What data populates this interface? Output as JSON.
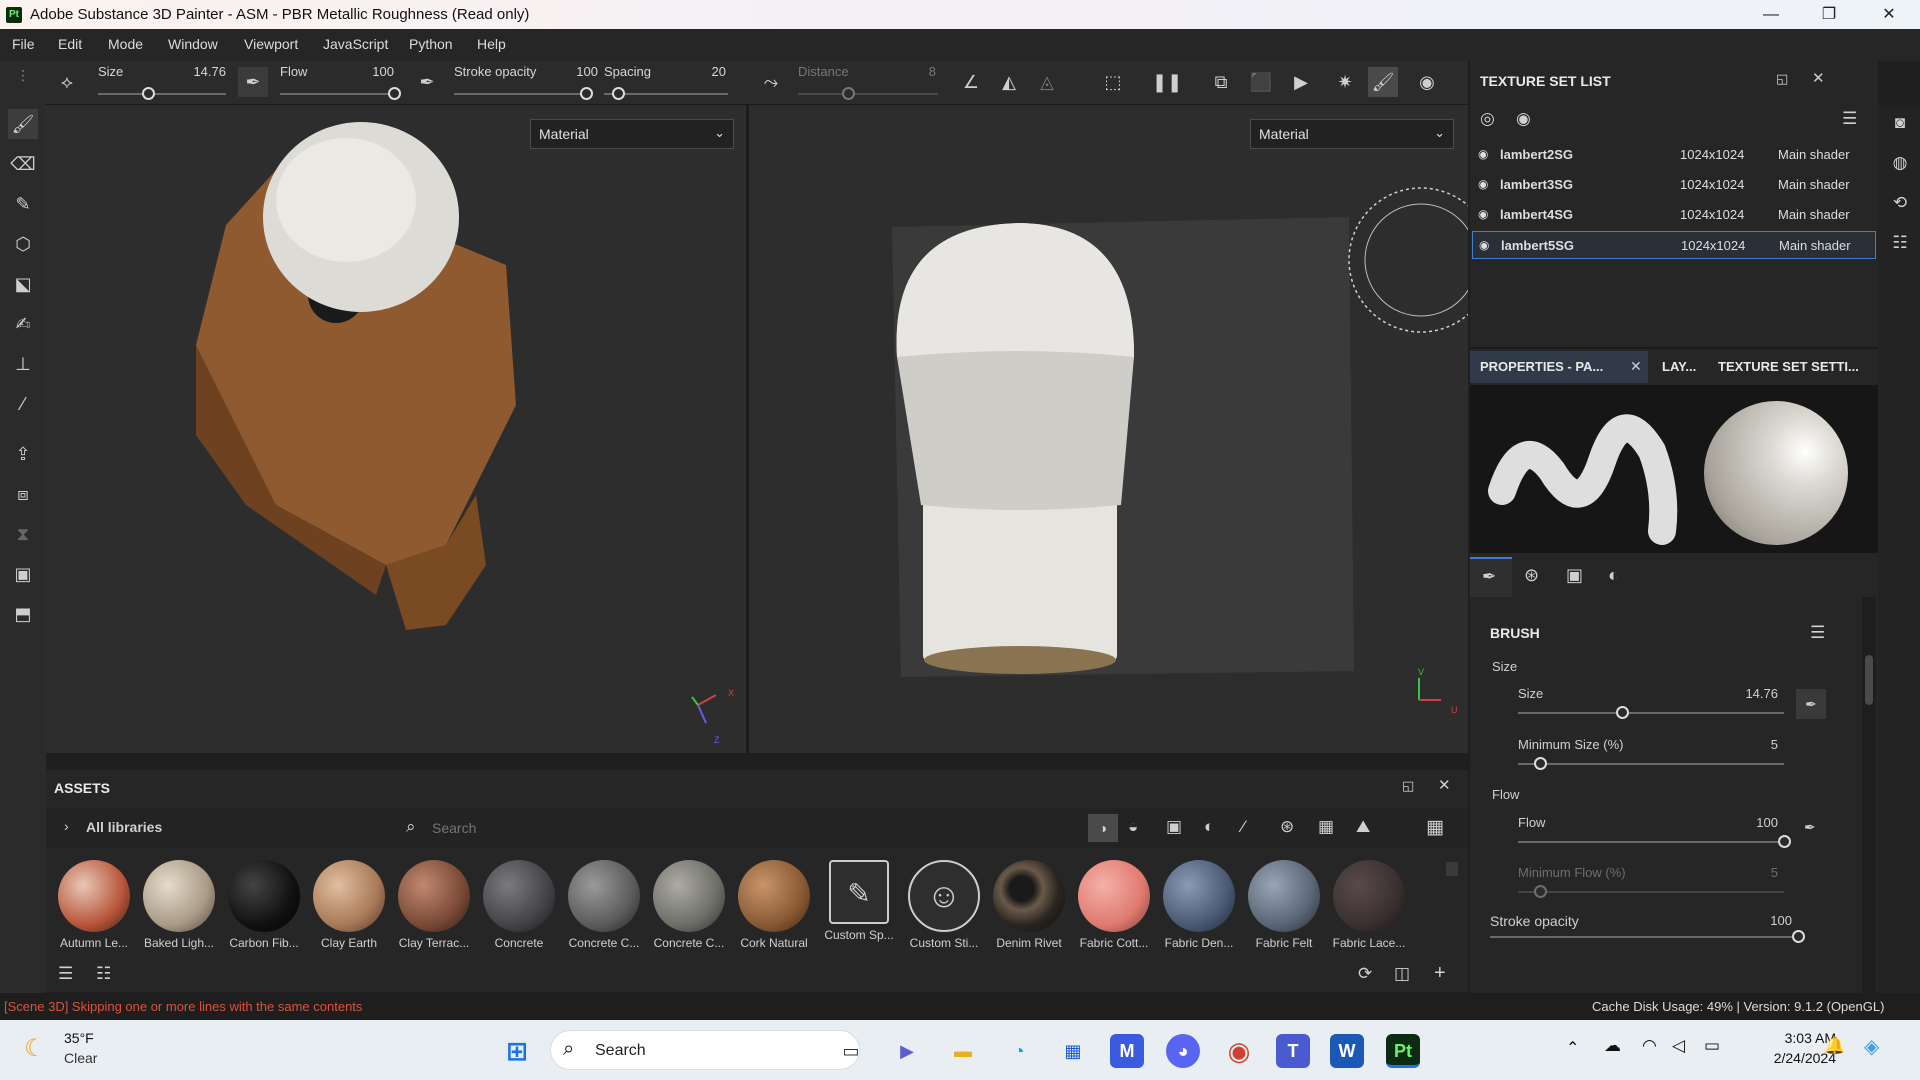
{
  "window": {
    "app_icon": "Pt",
    "title": "Adobe Substance 3D Painter - ASM - PBR Metallic Roughness (Read only)"
  },
  "menu": [
    "File",
    "Edit",
    "Mode",
    "Window",
    "Viewport",
    "JavaScript",
    "Python",
    "Help"
  ],
  "toolbar": {
    "size_label": "Size",
    "size_value": "14.76",
    "flow_label": "Flow",
    "flow_value": "100",
    "stroke_label": "Stroke opacity",
    "stroke_value": "100",
    "spacing_label": "Spacing",
    "spacing_value": "20",
    "distance_label": "Distance",
    "distance_value": "8"
  },
  "viewport3d": {
    "dropdown": "Material",
    "axis_x": "X",
    "axis_z": "Z"
  },
  "viewport2d": {
    "dropdown": "Material",
    "axis_v": "V",
    "axis_u": "U"
  },
  "texture_set_list": {
    "title": "TEXTURE SET LIST",
    "rows": [
      {
        "name": "lambert2SG",
        "res": "1024x1024",
        "shader": "Main shader"
      },
      {
        "name": "lambert3SG",
        "res": "1024x1024",
        "shader": "Main shader"
      },
      {
        "name": "lambert4SG",
        "res": "1024x1024",
        "shader": "Main shader"
      },
      {
        "name": "lambert5SG",
        "res": "1024x1024",
        "shader": "Main shader"
      }
    ]
  },
  "properties": {
    "tabs": [
      "PROPERTIES - PA...",
      "LAY...",
      "TEXTURE SET SETTI..."
    ],
    "brush_title": "BRUSH",
    "size_group": "Size",
    "size_label": "Size",
    "size_value": "14.76",
    "minsize_label": "Minimum Size (%)",
    "minsize_value": "5",
    "flow_group": "Flow",
    "flow_label": "Flow",
    "flow_value": "100",
    "minflow_label": "Minimum Flow (%)",
    "minflow_value": "5",
    "stroke_label": "Stroke opacity",
    "stroke_value": "100"
  },
  "assets": {
    "title": "ASSETS",
    "libraries": "All libraries",
    "search_placeholder": "Search",
    "items": [
      {
        "name": "Autumn Le...",
        "color": "#b8563a"
      },
      {
        "name": "Baked Ligh...",
        "color": "#a89a86"
      },
      {
        "name": "Carbon Fib...",
        "color": "#111111"
      },
      {
        "name": "Clay Earth",
        "color": "#a87a58"
      },
      {
        "name": "Clay Terrac...",
        "color": "#7a4a36"
      },
      {
        "name": "Concrete",
        "color": "#444448"
      },
      {
        "name": "Concrete C...",
        "color": "#5c5c5c"
      },
      {
        "name": "Concrete C...",
        "color": "#6e6e68"
      },
      {
        "name": "Cork Natural",
        "color": "#8a5a34"
      },
      {
        "name": "Custom Sp...",
        "color": "#2e2e2e"
      },
      {
        "name": "Custom Sti...",
        "color": "#2e2e2e"
      },
      {
        "name": "Denim Rivet",
        "color": "#2a2520"
      },
      {
        "name": "Fabric Cott...",
        "color": "#e07a70"
      },
      {
        "name": "Fabric Den...",
        "color": "#4a5a74"
      },
      {
        "name": "Fabric Felt",
        "color": "#5a6676"
      },
      {
        "name": "Fabric Lace...",
        "color": "#3a3030"
      }
    ]
  },
  "status": {
    "message": "[Scene 3D] Skipping one or more lines with the same contents",
    "cache": "Cache Disk Usage:  49% | Version: 9.1.2 (OpenGL)"
  },
  "taskbar": {
    "weather_temp": "35°F",
    "weather_desc": "Clear",
    "search": "Search",
    "time": "3:03 AM",
    "date": "2/24/2024"
  }
}
